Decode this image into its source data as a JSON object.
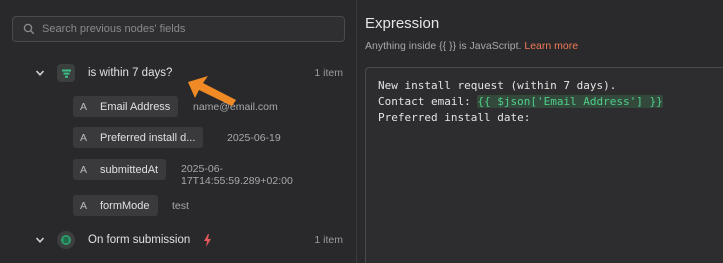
{
  "search": {
    "placeholder": "Search previous nodes' fields"
  },
  "nodes": [
    {
      "name": "is within 7 days?",
      "count": "1 item",
      "fields": [
        {
          "type": "A",
          "name": "Email Address",
          "value": "name@email.com"
        },
        {
          "type": "A",
          "name": "Preferred install d...",
          "value": "2025-06-19"
        },
        {
          "type": "A",
          "name": "submittedAt",
          "value_line1": "2025-06-",
          "value_line2": "17T14:55:59.289+02:00"
        },
        {
          "type": "A",
          "name": "formMode",
          "value": "test"
        }
      ]
    },
    {
      "name": "On form submission",
      "count": "1 item"
    }
  ],
  "expression": {
    "title": "Expression",
    "hint_prefix": "Anything inside ",
    "hint_braces": "{{  }}",
    "hint_suffix": " is JavaScript. ",
    "learn_more": "Learn more",
    "lines": [
      "New install request (within 7 days).",
      "Contact email: ",
      "Preferred install date:"
    ],
    "inline_expression": "{{ $json['Email Address'] }}"
  },
  "colors": {
    "accent": "#f07b57",
    "expression_green": "#4fcf8a",
    "node_icon_green": "#3cc08a"
  },
  "icons": [
    "search-icon",
    "chevron-down-icon",
    "filter-node-icon",
    "form-trigger-icon",
    "lightning-icon",
    "cursor-arrow-icon"
  ]
}
